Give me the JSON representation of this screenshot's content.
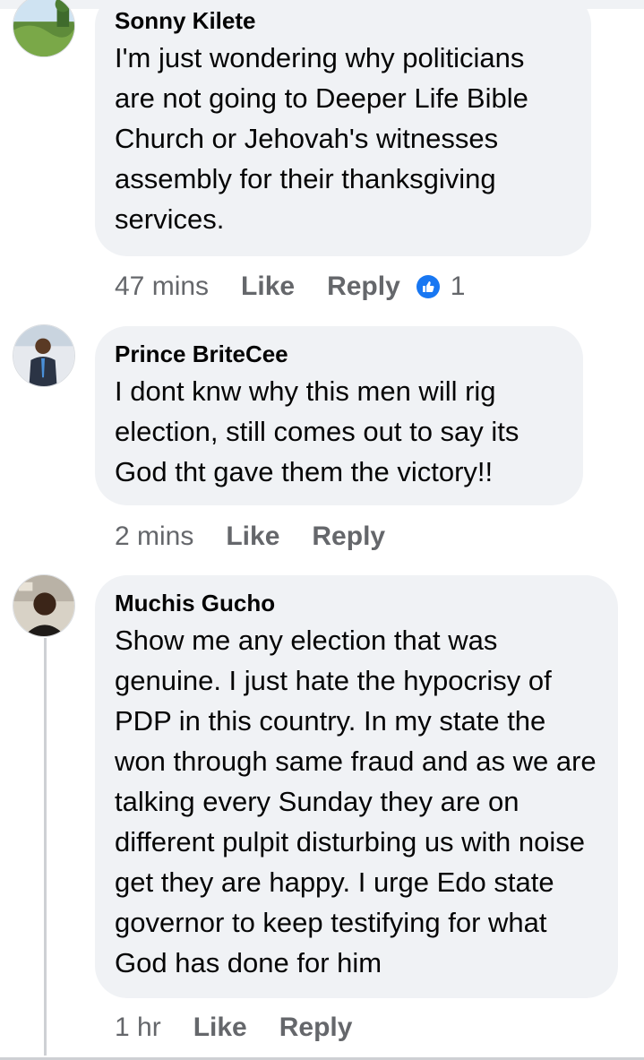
{
  "comments": [
    {
      "author": "Sonny Kilete",
      "text": "I'm just wondering why politicians are not going to Deeper Life Bible Church or Jehovah's witnesses assembly for their thanksgiving services.",
      "time": "47 mins",
      "like_label": "Like",
      "reply_label": "Reply",
      "reaction_count": "1",
      "reaction_icon": "like-icon"
    },
    {
      "author": "Prince BriteCee",
      "text": "I dont knw why this men will rig election, still comes out to say its God tht gave them the victory!!",
      "time": "2 mins",
      "like_label": "Like",
      "reply_label": "Reply"
    },
    {
      "author": "Muchis Gucho",
      "text": "Show me any election that was genuine. I just hate the hypocrisy of PDP in this country. In my state the won through same fraud and as we are talking every Sunday they are on different pulpit disturbing us with noise get they are happy. I urge Edo state governor to keep testifying for what God has done for him",
      "time": "1 hr",
      "like_label": "Like",
      "reply_label": "Reply"
    }
  ],
  "colors": {
    "bubble": "#f0f2f5",
    "meta_text": "#65676b",
    "like_badge": "#1877f2"
  }
}
